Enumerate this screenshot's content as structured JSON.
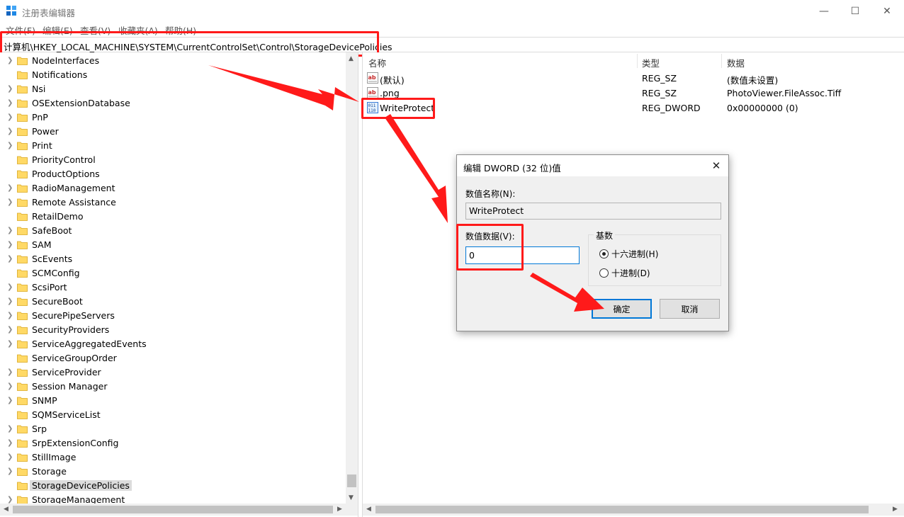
{
  "window": {
    "title": "注册表编辑器",
    "minimize": "—",
    "maximize": "☐",
    "close": "✕"
  },
  "menu": [
    "文件(F)",
    "编辑(E)",
    "查看(V)",
    "收藏夹(A)",
    "帮助(H)"
  ],
  "address": "计算机\\HKEY_LOCAL_MACHINE\\SYSTEM\\CurrentControlSet\\Control\\StorageDevicePolicies",
  "tree": {
    "items": [
      {
        "label": "NodeInterfaces",
        "expandable": true
      },
      {
        "label": "Notifications",
        "expandable": false
      },
      {
        "label": "Nsi",
        "expandable": true
      },
      {
        "label": "OSExtensionDatabase",
        "expandable": true
      },
      {
        "label": "PnP",
        "expandable": true
      },
      {
        "label": "Power",
        "expandable": true
      },
      {
        "label": "Print",
        "expandable": true
      },
      {
        "label": "PriorityControl",
        "expandable": false
      },
      {
        "label": "ProductOptions",
        "expandable": false
      },
      {
        "label": "RadioManagement",
        "expandable": true
      },
      {
        "label": "Remote Assistance",
        "expandable": true
      },
      {
        "label": "RetailDemo",
        "expandable": false
      },
      {
        "label": "SafeBoot",
        "expandable": true
      },
      {
        "label": "SAM",
        "expandable": true
      },
      {
        "label": "ScEvents",
        "expandable": true
      },
      {
        "label": "SCMConfig",
        "expandable": false
      },
      {
        "label": "ScsiPort",
        "expandable": true
      },
      {
        "label": "SecureBoot",
        "expandable": true
      },
      {
        "label": "SecurePipeServers",
        "expandable": true
      },
      {
        "label": "SecurityProviders",
        "expandable": true
      },
      {
        "label": "ServiceAggregatedEvents",
        "expandable": true
      },
      {
        "label": "ServiceGroupOrder",
        "expandable": false
      },
      {
        "label": "ServiceProvider",
        "expandable": true
      },
      {
        "label": "Session Manager",
        "expandable": true
      },
      {
        "label": "SNMP",
        "expandable": true
      },
      {
        "label": "SQMServiceList",
        "expandable": false
      },
      {
        "label": "Srp",
        "expandable": true
      },
      {
        "label": "SrpExtensionConfig",
        "expandable": true
      },
      {
        "label": "StillImage",
        "expandable": true
      },
      {
        "label": "Storage",
        "expandable": true
      },
      {
        "label": "StorageDevicePolicies",
        "expandable": false,
        "selected": true
      },
      {
        "label": "StorageManagement",
        "expandable": true
      }
    ]
  },
  "list": {
    "headers": {
      "name": "名称",
      "type": "类型",
      "data": "数据"
    },
    "rows": [
      {
        "name": "(默认)",
        "type": "REG_SZ",
        "data": "(数值未设置)",
        "icon": "string-value-icon"
      },
      {
        "name": ".png",
        "type": "REG_SZ",
        "data": "PhotoViewer.FileAssoc.Tiff",
        "icon": "string-value-icon"
      },
      {
        "name": "WriteProtect",
        "type": "REG_DWORD",
        "data": "0x00000000 (0)",
        "icon": "dword-value-icon"
      }
    ]
  },
  "dialog": {
    "title": "编辑 DWORD (32 位)值",
    "close": "✕",
    "name_label": "数值名称(N):",
    "name_value": "WriteProtect",
    "data_label": "数值数据(V):",
    "data_value": "0",
    "base_label": "基数",
    "radio_hex": "十六进制(H)",
    "radio_dec": "十进制(D)",
    "selected_base": "hex",
    "ok": "确定",
    "cancel": "取消"
  },
  "colors": {
    "annotation": "#ff1a1a",
    "accent": "#0078d7",
    "folder": "#ffd966"
  }
}
